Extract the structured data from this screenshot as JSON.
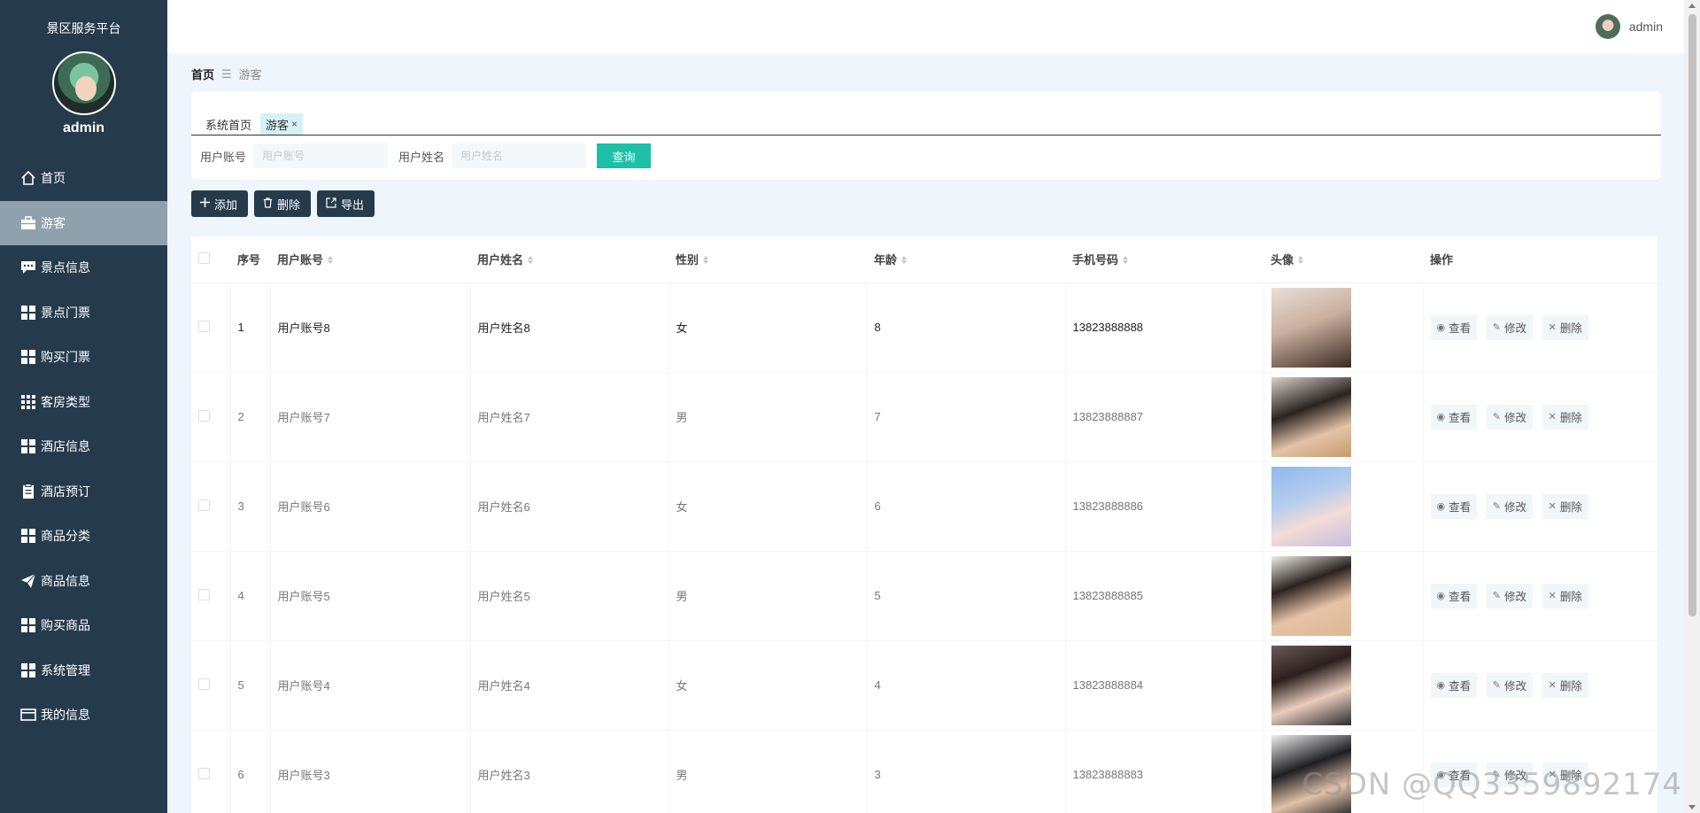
{
  "sidebar": {
    "app_title": "景区服务平台",
    "user_name": "admin",
    "items": [
      {
        "label": "首页",
        "icon": "home-icon"
      },
      {
        "label": "游客",
        "icon": "briefcase-icon",
        "active": true
      },
      {
        "label": "景点信息",
        "icon": "chat-icon"
      },
      {
        "label": "景点门票",
        "icon": "grid-icon"
      },
      {
        "label": "购买门票",
        "icon": "grid-icon"
      },
      {
        "label": "客房类型",
        "icon": "grid9-icon"
      },
      {
        "label": "酒店信息",
        "icon": "grid-icon"
      },
      {
        "label": "酒店预订",
        "icon": "clipboard-icon"
      },
      {
        "label": "商品分类",
        "icon": "grid-icon"
      },
      {
        "label": "商品信息",
        "icon": "paper-plane-icon"
      },
      {
        "label": "购买商品",
        "icon": "grid-icon"
      },
      {
        "label": "系统管理",
        "icon": "grid-icon"
      },
      {
        "label": "我的信息",
        "icon": "card-icon"
      }
    ]
  },
  "topbar": {
    "user_name": "admin"
  },
  "breadcrumb": {
    "home": "首页",
    "separator": "☰",
    "current": "游客"
  },
  "tabs": [
    {
      "label": "系统首页"
    },
    {
      "label": "游客",
      "close": "×"
    }
  ],
  "search": {
    "account_label": "用户账号",
    "account_placeholder": "用户账号",
    "name_label": "用户姓名",
    "name_placeholder": "用户姓名",
    "query_button": "查询"
  },
  "actions": {
    "add": "添加",
    "delete": "删除",
    "export": "导出"
  },
  "table": {
    "headers": [
      "序号",
      "用户账号",
      "用户姓名",
      "性别",
      "年龄",
      "手机号码",
      "头像",
      "操作"
    ],
    "op_view": "查看",
    "op_edit": "修改",
    "op_delete": "删除",
    "rows": [
      {
        "index": "1",
        "account": "用户账号8",
        "name": "用户姓名8",
        "gender": "女",
        "age": "8",
        "phone": "13823888888"
      },
      {
        "index": "2",
        "account": "用户账号7",
        "name": "用户姓名7",
        "gender": "男",
        "age": "7",
        "phone": "13823888887"
      },
      {
        "index": "3",
        "account": "用户账号6",
        "name": "用户姓名6",
        "gender": "女",
        "age": "6",
        "phone": "13823888886"
      },
      {
        "index": "4",
        "account": "用户账号5",
        "name": "用户姓名5",
        "gender": "男",
        "age": "5",
        "phone": "13823888885"
      },
      {
        "index": "5",
        "account": "用户账号4",
        "name": "用户姓名4",
        "gender": "女",
        "age": "4",
        "phone": "13823888884"
      },
      {
        "index": "6",
        "account": "用户账号3",
        "name": "用户姓名3",
        "gender": "男",
        "age": "3",
        "phone": "13823888883"
      }
    ]
  },
  "watermark": "CSDN @QQ3359892174",
  "colors": {
    "sidebar_bg": "#253b4c",
    "accent": "#1fc0a8",
    "active_item": "#8fa1ad",
    "page_bg": "#eef5fb"
  }
}
